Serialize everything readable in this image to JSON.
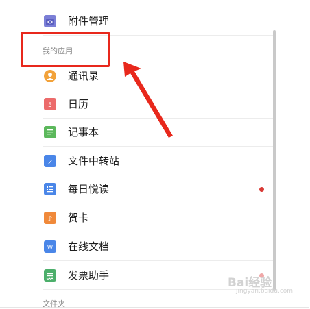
{
  "list": {
    "items": [
      {
        "label": "附件管理",
        "icon": "attachment-icon",
        "color": "#7b7fd6"
      },
      {
        "label": "通讯录",
        "icon": "contacts-icon",
        "color": "#f2a23a"
      },
      {
        "label": "日历",
        "icon": "calendar-icon",
        "color": "#ec6b6b",
        "glyph": "5"
      },
      {
        "label": "记事本",
        "icon": "notepad-icon",
        "color": "#5cb85c"
      },
      {
        "label": "文件中转站",
        "icon": "file-transfer-icon",
        "color": "#4a86e8",
        "glyph": "Z"
      },
      {
        "label": "每日悦读",
        "icon": "daily-reading-icon",
        "color": "#4a86e8"
      },
      {
        "label": "贺卡",
        "icon": "greeting-card-icon",
        "color": "#f0893a",
        "glyph": "♪"
      },
      {
        "label": "在线文档",
        "icon": "online-doc-icon",
        "color": "#4a86e8",
        "glyph": "W"
      },
      {
        "label": "发票助手",
        "icon": "invoice-icon",
        "color": "#4caf6b"
      }
    ]
  },
  "sections": {
    "my_apps": "我的应用",
    "files": "文件夹"
  },
  "watermark": {
    "text": "Bai经验",
    "sub": "jingyan.baidu.com"
  },
  "colors": {
    "annotation": "#e8281c",
    "badge": "#d93a35"
  }
}
